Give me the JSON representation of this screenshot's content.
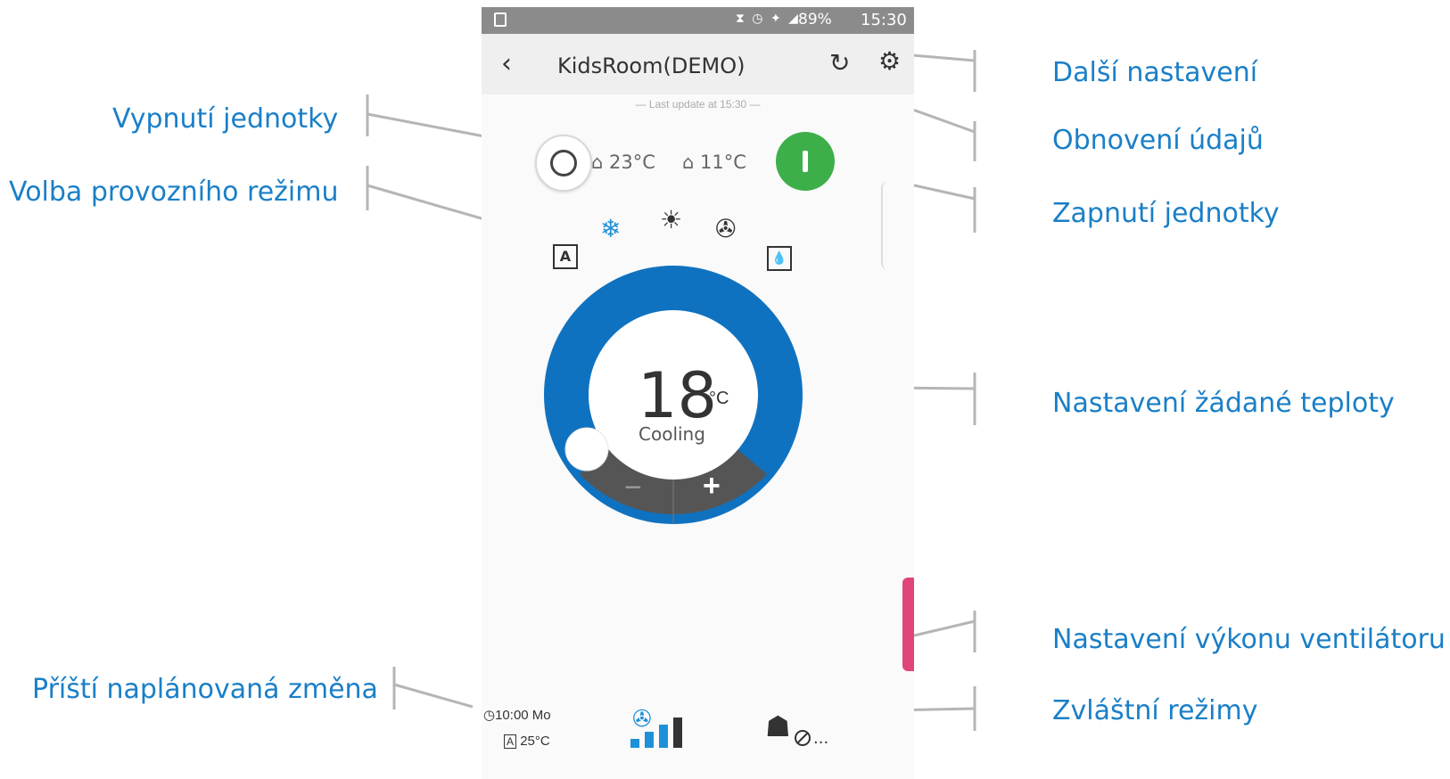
{
  "status_bar": {
    "battery": "89%",
    "time": "15:30"
  },
  "header": {
    "title": "KidsRoom(DEMO)"
  },
  "last_update": "— Last update at 15:30 —",
  "indoor_temp": "23°C",
  "outdoor_temp": "11°C",
  "modes": {
    "auto_label": "A"
  },
  "setpoint": {
    "value": "18",
    "unit": "°C",
    "mode": "Cooling",
    "minus": "−",
    "plus": "+"
  },
  "schedule": {
    "time": "10:00 Mo",
    "auto_label": "A",
    "temp": "25°C"
  },
  "fan_speed": {
    "level": 3,
    "max": 4
  },
  "special": {
    "more": "..."
  },
  "annotations": {
    "more_settings": "Další nastavení",
    "refresh": "Obnovení údajů",
    "power_off": "Vypnutí jednotky",
    "power_on": "Zapnutí jednotky",
    "mode_select": "Volba provozního režimu",
    "setpoint": "Nastavení žádané teploty",
    "fan": "Nastavení výkonu ventilátoru",
    "next_schedule": "Příští naplánovaná změna",
    "special_modes": "Zvláštní režimy"
  },
  "colors": {
    "accent": "#1a7fc7",
    "dial": "#0f72c0",
    "on": "#3daf4a",
    "off_ring": "#444444",
    "pink": "#e0467a"
  },
  "icons": [
    "back-icon",
    "refresh-icon",
    "gear-icon",
    "indoor-icon",
    "outdoor-icon",
    "snowflake-icon",
    "sun-icon",
    "fan-icon",
    "drop-icon",
    "clock-icon"
  ]
}
